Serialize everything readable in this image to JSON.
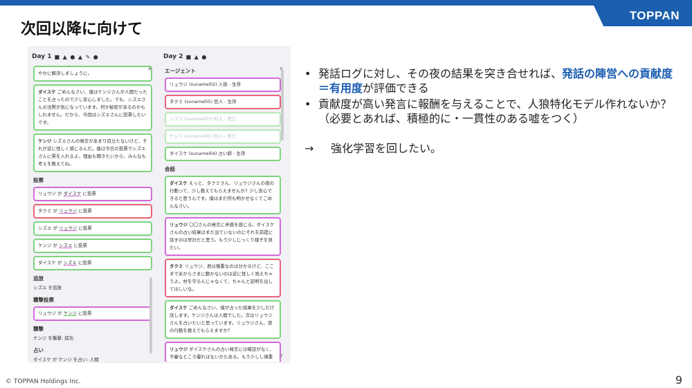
{
  "header": {
    "logo": "TOPPAN",
    "title": "次回以降に向けて"
  },
  "panel": {
    "day1": {
      "title": "Day 1",
      "icons": [
        "chat-icon",
        "person-icon",
        "vote-icon",
        "exile-icon",
        "wolf-icon",
        "role-icon"
      ],
      "cards_top": [
        {
          "speaker": "",
          "text": "やかに解決しましょうに。"
        },
        {
          "speaker": "ダイスケ",
          "text": "ごめんなさい、僕はケンジさんが人間だったことを占ったので少し安心しました。でも、シズエさんの沈黙が気になっています。何か秘密があるのかもしれません。だから、今回はシズエさんに投票したいです。"
        },
        {
          "speaker": "ケンジ",
          "text": "シズエさんの発言があまり目立たないけど、それが逆に怪しく感じるんだ。僕は今日の投票でシズエさんに票を入れるよ。理由も聞きたいから、みんなも考えを教えてね。"
        }
      ],
      "vote_label": "投票",
      "votes": [
        {
          "from": "リュウジ",
          "to": "ダイスケ",
          "suffix": "に投票"
        },
        {
          "from": "タクミ",
          "to": "リュウジ",
          "suffix": "に投票"
        },
        {
          "from": "シズエ",
          "to": "リュウジ",
          "suffix": "に投票"
        },
        {
          "from": "ケンジ",
          "to": "シズエ",
          "suffix": "に投票"
        },
        {
          "from": "ダイスケ",
          "to": "シズエ",
          "suffix": "に投票"
        }
      ],
      "exile_label": "追放",
      "exile_text": "シズエ を追放",
      "attack_vote_label": "襲撃投票",
      "attack_vote": {
        "from": "リュウジ",
        "to": "ケンジ",
        "suffix": "に投票"
      },
      "attack_label": "襲撃",
      "attack_text": "ケンジ を襲撃: 成功",
      "divine_label": "占い",
      "divine_text": "ダイスケ が ケンジ を占い: 人間"
    },
    "day2": {
      "title": "Day 2",
      "icons": [
        "chat-icon",
        "person-icon",
        "vote-icon"
      ],
      "agents_label": "エージェント",
      "agents": [
        {
          "text": "リュウジ (sunamelli2) 人狼 - 生存"
        },
        {
          "text": "タクミ (sunamelli5) 狂人 - 生存"
        },
        {
          "text": "シズエ (sunamelli3) 村人 - 死亡"
        },
        {
          "text": "ケンジ (sunamelli1) 村人 - 死亡"
        },
        {
          "text": "ダイスケ (sunamelli4) 占い師 - 生存"
        }
      ],
      "talk_label": "会話",
      "talks": [
        {
          "speaker": "ダイスケ",
          "text": "えっと、タクミさん、リュウジさんの夜の行動って、少し教えてもらえませんか？少し安心できると思うんです。僕はまだ何も明かせなくてごめんなさい。"
        },
        {
          "speaker": "リュウジ",
          "text": "〇〇さんの発言に矛盾を感じる。ダイスケさんの占い結果はまだ出ていないのにそれを前提に話すのは早計だと思う。もう少しじっくり様子を見たい。"
        },
        {
          "speaker": "タクミ",
          "text": "リュウジ、君は慎重なのは分かるけど、ここまであからさまに動かないのは逆に怪しく見えちゃうよ。村を守るんじゃなくて、ちゃんと証明を出してほしいな。"
        },
        {
          "speaker": "ダイスケ",
          "text": "ごめんなさい、僕が占った結果を少しだけ話します。ケンジさんは人間でした。次はリュウジさんを占いたいと思っています。リュウジさん、夜の行動を教えてもらえますか？"
        },
        {
          "speaker": "リュウジ",
          "text": "ダイスケさんの占い発言には確証がなく、不審なところ優れはないかたある。もう少しし慎重に"
        }
      ]
    }
  },
  "bullets": {
    "b1_pre": "発話ログに対し、その夜の結果を突き合せれば、",
    "b1_hl": "発話の陣営への貢献度＝有用度",
    "b1_post": "が評価できる",
    "b2": "貢献度が高い発言に報酬を与えることで、人狼特化モデル作れないか？（必要とあれば、積極的に・一貫性のある嘘をつく）",
    "bullet_mark": "•",
    "arrow": "→",
    "arrow_text": "強化学習を回したい。"
  },
  "footer": {
    "copyright": "© TOPPAN Holdings Inc.",
    "page": "9"
  },
  "colors": {
    "brand": "#1b5fae",
    "highlight": "#1a5cb0",
    "green_card": "#7ed47e",
    "purple_card": "#d26ad8",
    "red_card": "#e8627a"
  }
}
